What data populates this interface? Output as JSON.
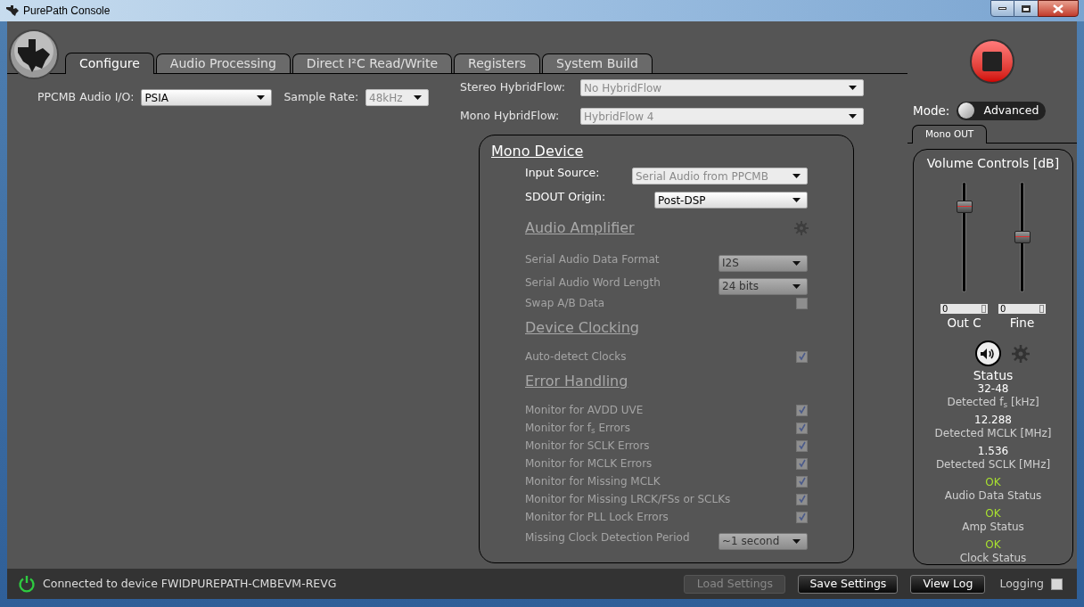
{
  "window": {
    "title": "PurePath Console"
  },
  "tabs": [
    {
      "label": "Configure",
      "selected": true
    },
    {
      "label": "Audio Processing",
      "selected": false
    },
    {
      "label": "Direct I²C Read/Write",
      "selected": false
    },
    {
      "label": "Registers",
      "selected": false
    },
    {
      "label": "System Build",
      "selected": false
    }
  ],
  "io": [
    {
      "label": "PPCMB Audio I/O:",
      "value": "PSIA",
      "disabled": false
    },
    {
      "label": "Sample Rate:",
      "value": "48kHz",
      "disabled": true
    }
  ],
  "hybridflow": [
    {
      "label": "Stereo HybridFlow:",
      "value": "No HybridFlow",
      "disabled": true
    },
    {
      "label": "Mono HybridFlow:",
      "value": "HybridFlow 4",
      "disabled": true
    }
  ],
  "mono_device": {
    "title": "Mono Device",
    "selects": [
      {
        "label": "Input Source:",
        "value": "Serial Audio from PPCMB",
        "disabled": true
      },
      {
        "label": "SDOUT Origin:",
        "value": "Post-DSP",
        "disabled": false
      }
    ],
    "sections": [
      {
        "title": "Audio Amplifier",
        "disabled": true,
        "gear": true,
        "rows": [
          {
            "kind": "select",
            "label": "Serial Audio Data Format",
            "value": "I2S"
          },
          {
            "kind": "select",
            "label": "Serial Audio Word Length",
            "value": "24 bits"
          },
          {
            "kind": "checkbox",
            "label": "Swap A/B Data",
            "checked": false
          }
        ]
      },
      {
        "title": "Device Clocking",
        "disabled": true,
        "gear": false,
        "rows": [
          {
            "kind": "checkbox",
            "label": "Auto-detect Clocks",
            "checked": true
          }
        ]
      },
      {
        "title": "Error Handling",
        "disabled": true,
        "gear": false,
        "rows": [
          {
            "kind": "checkbox",
            "label": "Monitor for AVDD UVE",
            "checked": true
          },
          {
            "kind": "checkbox",
            "label": "Monitor for f$_{s}$ Errors",
            "checked": true
          },
          {
            "kind": "checkbox",
            "label": "Monitor for SCLK Errors",
            "checked": true
          },
          {
            "kind": "checkbox",
            "label": "Monitor for MCLK Errors",
            "checked": true
          },
          {
            "kind": "checkbox",
            "label": "Monitor for Missing MCLK",
            "checked": true
          },
          {
            "kind": "checkbox",
            "label": "Monitor for Missing LRCK/FSs or SCLKs",
            "checked": true
          },
          {
            "kind": "checkbox",
            "label": "Monitor for PLL Lock Errors",
            "checked": true
          },
          {
            "kind": "select",
            "label": "Missing Clock Detection Period",
            "value": "~1 second"
          }
        ]
      }
    ]
  },
  "mode": {
    "label": "Mode:",
    "value": "Advanced"
  },
  "right_tabs": [
    {
      "label": "Mono OUT",
      "selected": true
    }
  ],
  "volume": {
    "title": "Volume Controls [dB]",
    "sliders": [
      {
        "label": "Out C",
        "value": "0",
        "level": 0.82
      },
      {
        "label": "Fine",
        "value": "0",
        "level": 0.51
      }
    ]
  },
  "status": {
    "title": "Status",
    "items": [
      {
        "kind": "reading",
        "value": "32-48",
        "label": "Detected f$_{s}$ [kHz]"
      },
      {
        "kind": "reading",
        "value": "12.288",
        "label": "Detected MCLK [MHz]"
      },
      {
        "kind": "reading",
        "value": "1.536",
        "label": "Detected SCLK [MHz]"
      },
      {
        "kind": "ok",
        "value": "OK",
        "label": "Audio Data Status"
      },
      {
        "kind": "ok",
        "value": "OK",
        "label": "Amp Status"
      },
      {
        "kind": "ok",
        "value": "OK",
        "label": "Clock Status"
      }
    ]
  },
  "status_bar": {
    "message": "Connected to device FWIDPUREPATH-CMBEVM-REVG",
    "buttons": [
      {
        "label": "Load Settings",
        "disabled": true
      },
      {
        "label": "Save Settings",
        "disabled": false
      },
      {
        "label": "View Log",
        "disabled": false
      }
    ],
    "logging": {
      "label": "Logging",
      "checked": false
    }
  }
}
